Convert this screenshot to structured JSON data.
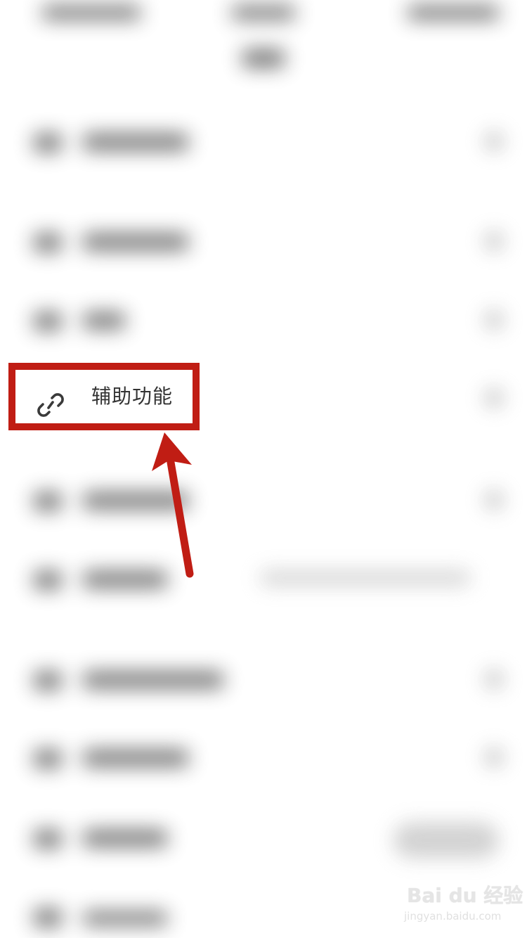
{
  "highlighted_item": {
    "label": "辅助功能",
    "icon": "link-icon"
  },
  "annotation": {
    "box_color": "#c01d14",
    "arrow_color": "#c01d14"
  },
  "watermark": {
    "brand": "Bai du 经验",
    "url": "jingyan.baidu.com"
  }
}
